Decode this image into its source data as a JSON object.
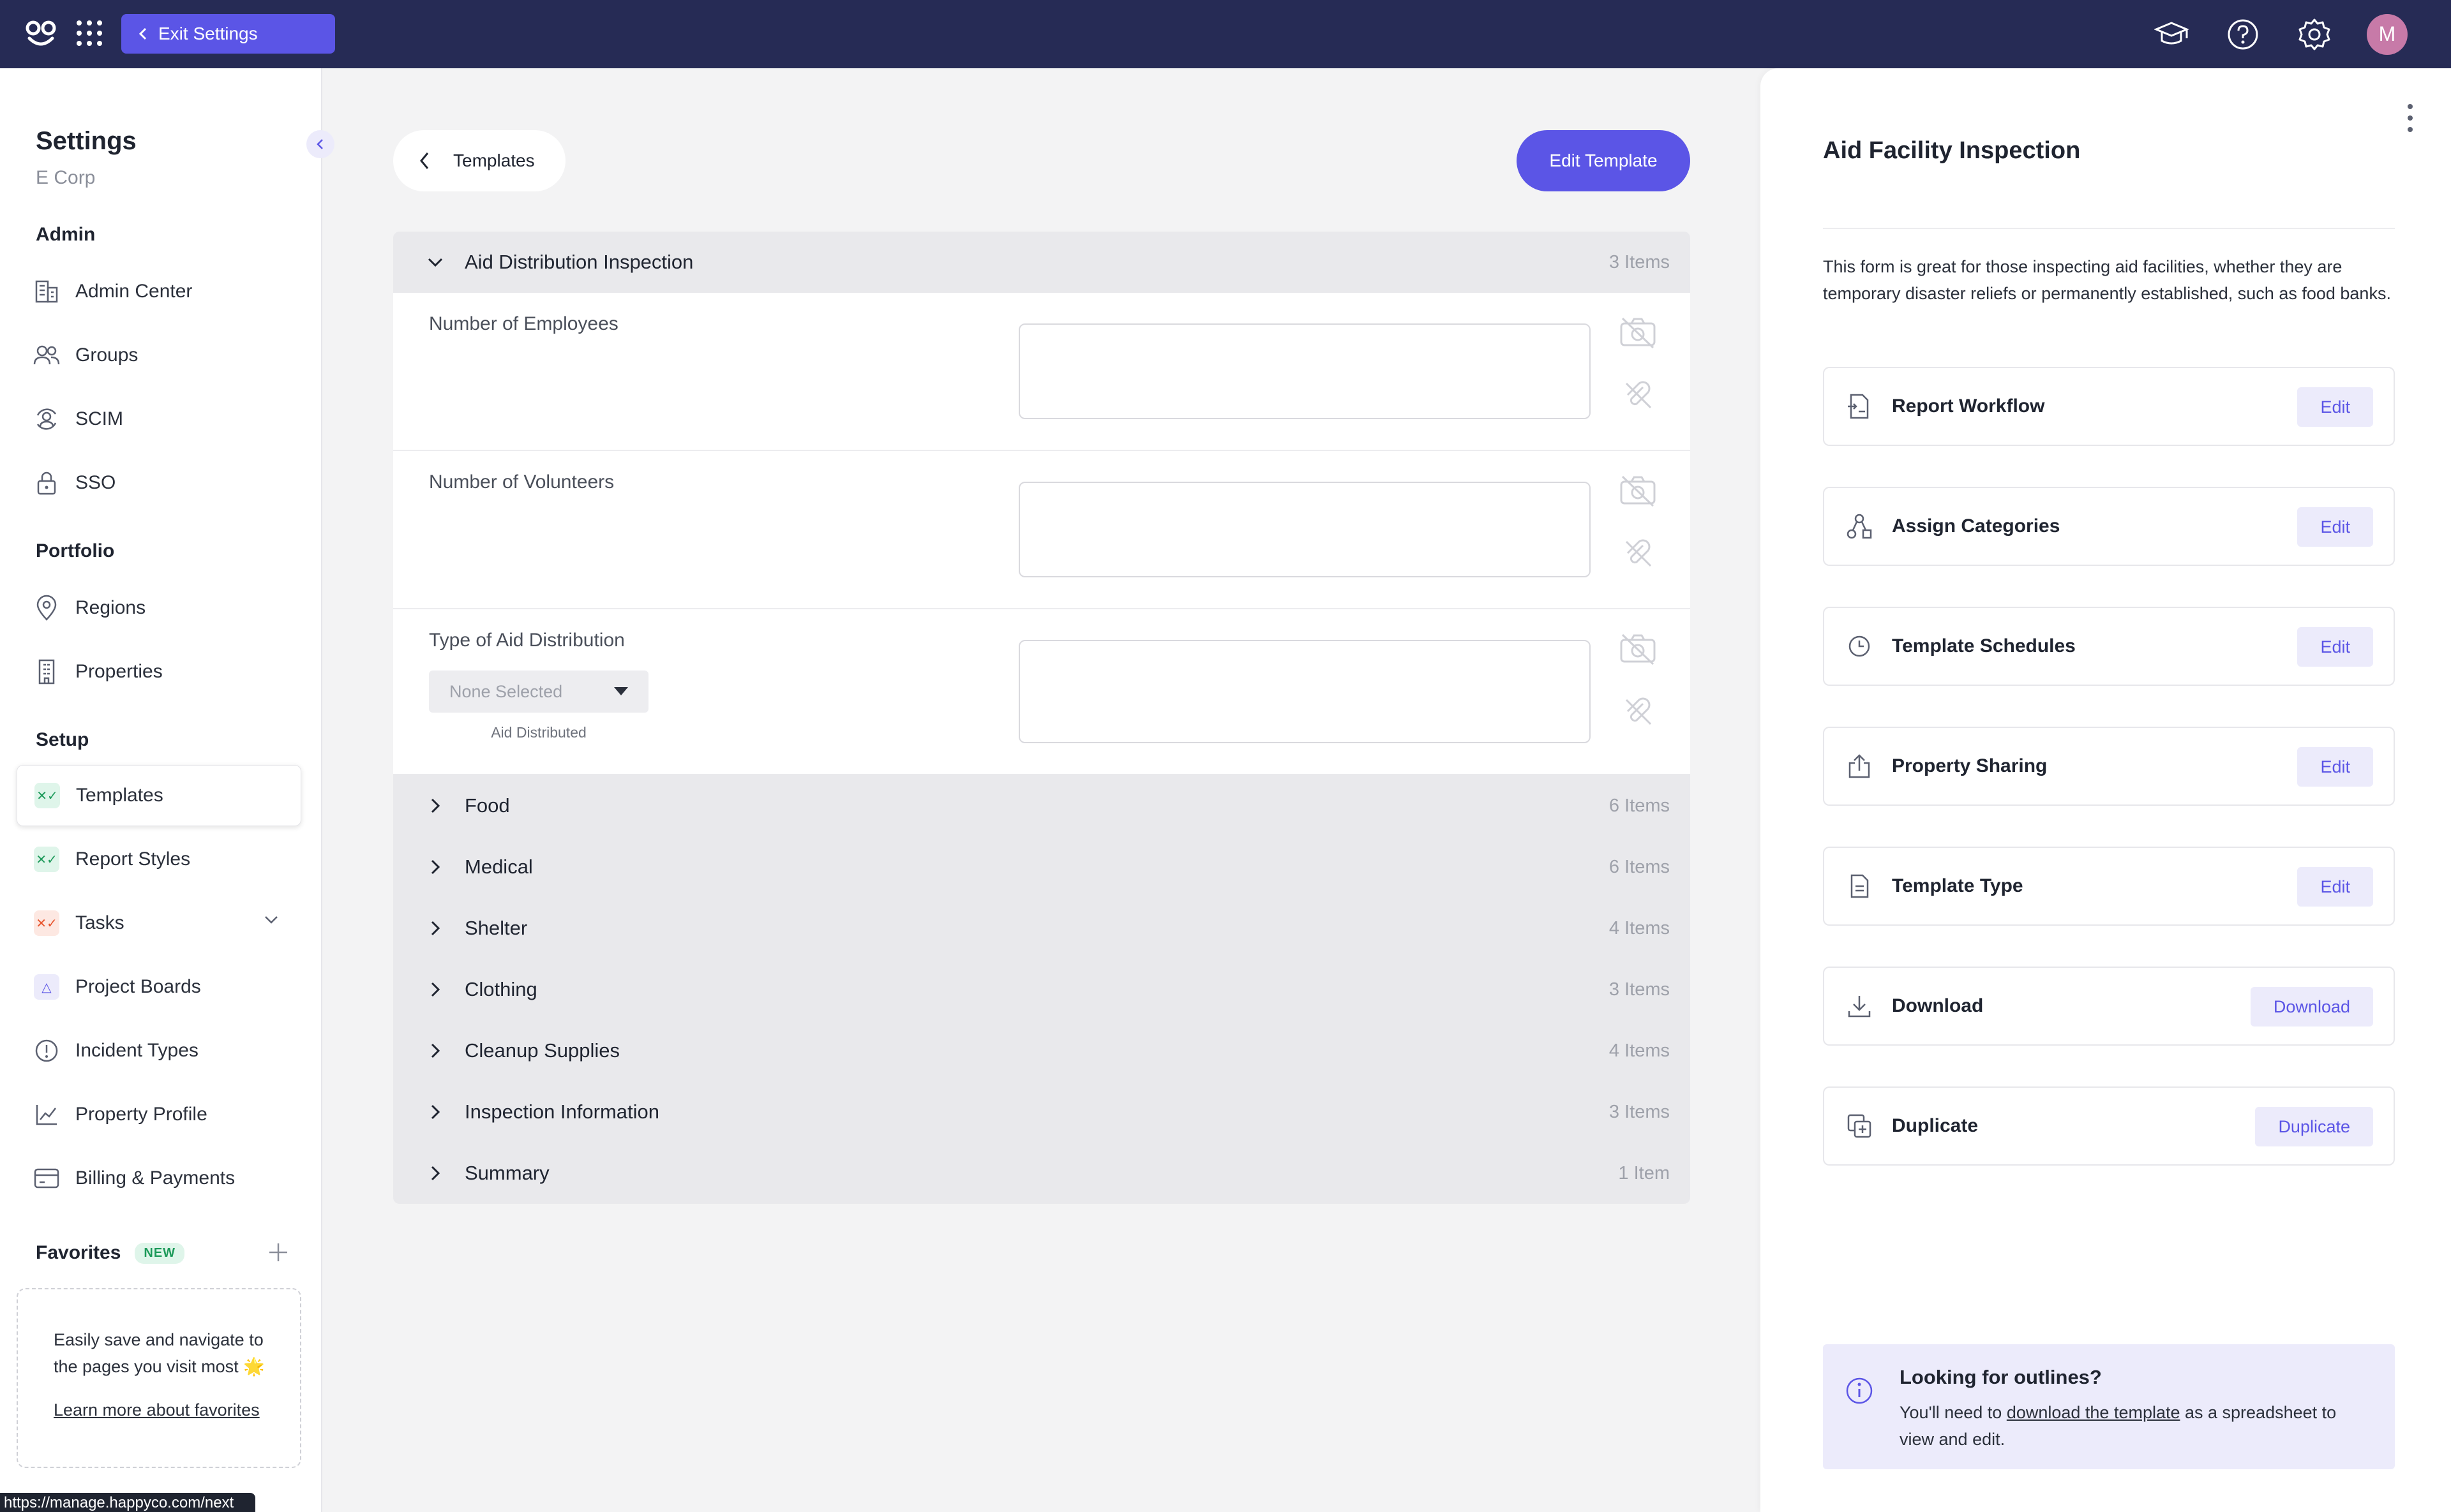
{
  "topbar": {
    "exit_label": "Exit Settings",
    "avatar_initial": "M"
  },
  "sidebar": {
    "title": "Settings",
    "org": "E Corp",
    "sections": {
      "admin": "Admin",
      "portfolio": "Portfolio",
      "setup": "Setup"
    },
    "items": {
      "admin_center": "Admin Center",
      "groups": "Groups",
      "scim": "SCIM",
      "sso": "SSO",
      "regions": "Regions",
      "properties": "Properties",
      "templates": "Templates",
      "report_styles": "Report Styles",
      "tasks": "Tasks",
      "project_boards": "Project Boards",
      "incident_types": "Incident Types",
      "property_profile": "Property Profile",
      "billing": "Billing & Payments"
    },
    "favorites": {
      "title": "Favorites",
      "badge": "NEW",
      "body": "Easily save and navigate to the pages you visit most 🌟",
      "link": "Learn more about favorites"
    },
    "url_tooltip": "https://manage.happyco.com/next"
  },
  "main": {
    "back_label": "Templates",
    "edit_template_label": "Edit Template",
    "open_section": {
      "name": "Aid Distribution Inspection",
      "count": "3 Items",
      "questions": [
        {
          "label": "Number of Employees"
        },
        {
          "label": "Number of Volunteers"
        },
        {
          "label": "Type of Aid Distribution",
          "dropdown_value": "None Selected",
          "dropdown_caption": "Aid Distributed"
        }
      ]
    },
    "sections": [
      {
        "name": "Food",
        "count": "6 Items"
      },
      {
        "name": "Medical",
        "count": "6 Items"
      },
      {
        "name": "Shelter",
        "count": "4 Items"
      },
      {
        "name": "Clothing",
        "count": "3 Items"
      },
      {
        "name": "Cleanup Supplies",
        "count": "4 Items"
      },
      {
        "name": "Inspection Information",
        "count": "3 Items"
      },
      {
        "name": "Summary",
        "count": "1 Item"
      }
    ]
  },
  "right_panel": {
    "title": "Aid Facility Inspection",
    "description": "This form is great for those inspecting aid facilities, whether they are temporary disaster reliefs or permanently established, such as food banks.",
    "cards": [
      {
        "label": "Report Workflow",
        "action": "Edit"
      },
      {
        "label": "Assign Categories",
        "action": "Edit"
      },
      {
        "label": "Template Schedules",
        "action": "Edit"
      },
      {
        "label": "Property Sharing",
        "action": "Edit"
      },
      {
        "label": "Template Type",
        "action": "Edit"
      },
      {
        "label": "Download",
        "action": "Download"
      },
      {
        "label": "Duplicate",
        "action": "Duplicate"
      }
    ],
    "info": {
      "heading": "Looking for outlines?",
      "text_before": "You'll need to ",
      "link": "download the template",
      "text_after": " as a spreadsheet to view and edit."
    }
  },
  "colors": {
    "topbar": "#262b55",
    "accent": "#5b55e6",
    "accent_soft": "#ecebfb"
  }
}
